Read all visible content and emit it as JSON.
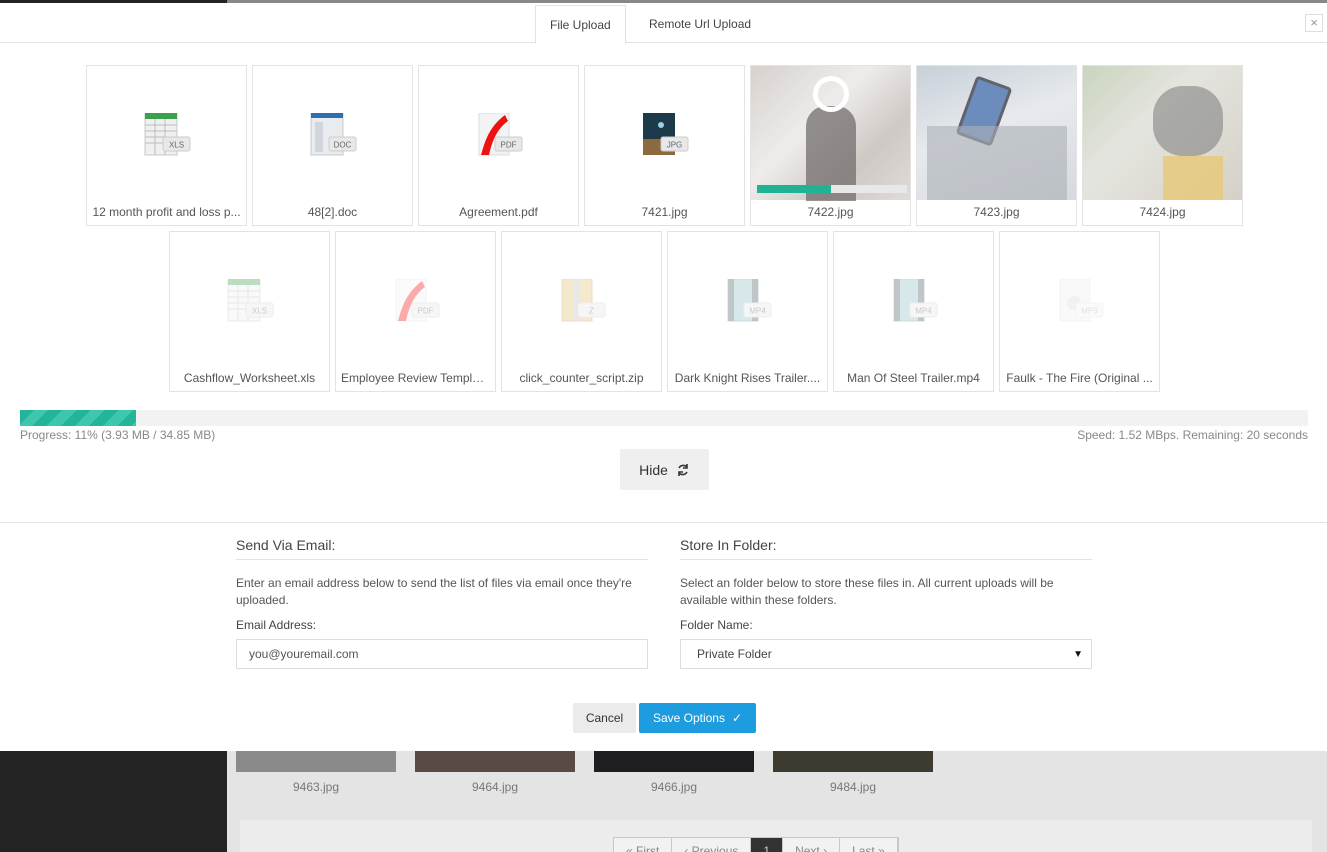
{
  "tabs": [
    {
      "label": "File Upload",
      "active": true
    },
    {
      "label": "Remote Url Upload",
      "active": false
    }
  ],
  "close_label": "×",
  "files_row1": [
    {
      "name": "12 month profit and loss p...",
      "type": "xls",
      "badge": "XLS"
    },
    {
      "name": "48[2].doc",
      "type": "doc",
      "badge": "DOC"
    },
    {
      "name": "Agreement.pdf",
      "type": "pdf",
      "badge": "PDF"
    },
    {
      "name": "7421.jpg",
      "type": "jpg",
      "badge": "JPG"
    },
    {
      "name": "7422.jpg",
      "type": "photo",
      "progress": 0.49
    },
    {
      "name": "7423.jpg",
      "type": "photo"
    },
    {
      "name": "7424.jpg",
      "type": "photo"
    }
  ],
  "files_row2": [
    {
      "name": "Cashflow_Worksheet.xls",
      "type": "xls",
      "badge": "XLS"
    },
    {
      "name": "Employee Review Templat...",
      "type": "pdf",
      "badge": "PDF"
    },
    {
      "name": "click_counter_script.zip",
      "type": "zip",
      "badge": "Z"
    },
    {
      "name": "Dark Knight Rises Trailer....",
      "type": "mp4",
      "badge": "MP4"
    },
    {
      "name": "Man Of Steel Trailer.mp4",
      "type": "mp4",
      "badge": "MP4"
    },
    {
      "name": "Faulk - The Fire (Original ...",
      "type": "mp3",
      "badge": "MP3"
    }
  ],
  "progress": {
    "percent": 0.09,
    "text": "Progress: 11% (3.93 MB / 34.85 MB)",
    "speed": "Speed: 1.52 MBps. Remaining: 20 seconds"
  },
  "hide_label": "Hide",
  "email_section": {
    "title": "Send Via Email:",
    "desc": "Enter an email address below to send the list of files via email once they're uploaded.",
    "label": "Email Address:",
    "value": "you@youremail.com"
  },
  "folder_section": {
    "title": "Store In Folder:",
    "desc": "Select an folder below to store these files in. All current uploads will be available within these folders.",
    "label": "Folder Name:",
    "selected": "Private Folder"
  },
  "cancel_label": "Cancel",
  "save_label": "Save Options",
  "save_check": "✓",
  "background": {
    "thumbs": [
      "9463.jpg",
      "9464.jpg",
      "9466.jpg",
      "9484.jpg"
    ],
    "pager": [
      "« First",
      "‹ Previous",
      "1",
      "Next ›",
      "Last »"
    ]
  },
  "colors": {
    "accent": "#1fb394",
    "primary_button": "#1e9ce0"
  }
}
